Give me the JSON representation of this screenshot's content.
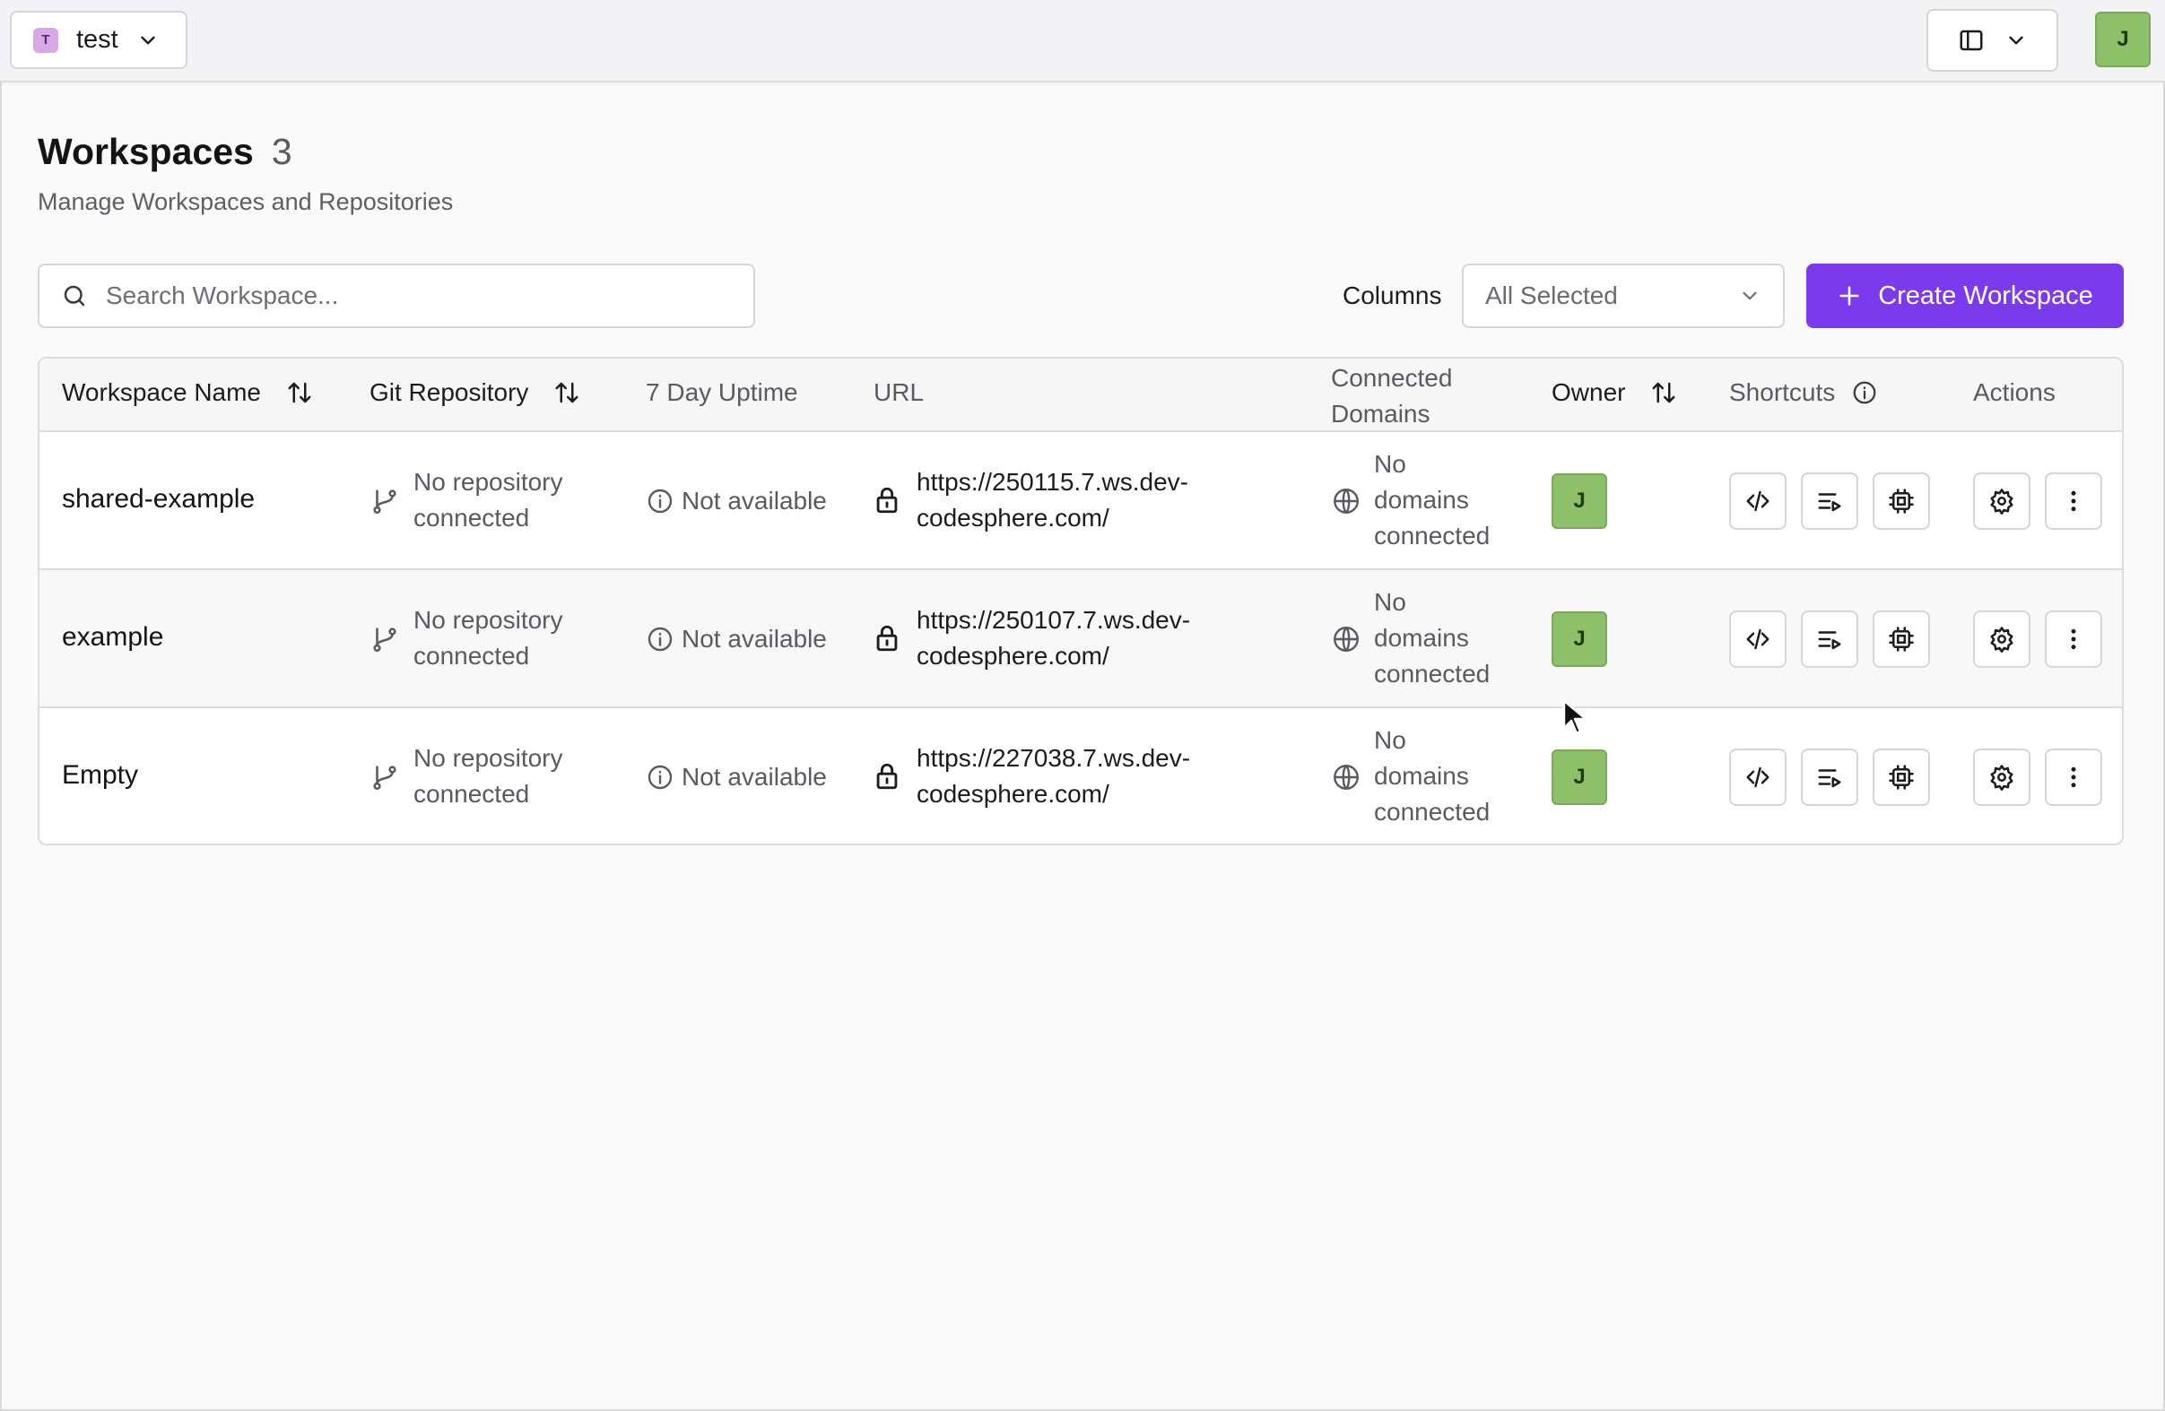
{
  "topbar": {
    "team_badge": "T",
    "team_name": "test",
    "user_initial": "J"
  },
  "header": {
    "title": "Workspaces",
    "count": "3",
    "subtitle": "Manage Workspaces and Repositories"
  },
  "toolbar": {
    "search_placeholder": "Search Workspace...",
    "columns_label": "Columns",
    "columns_value": "All Selected",
    "create_label": "Create Workspace"
  },
  "table": {
    "headers": {
      "name": "Workspace Name",
      "repo": "Git Repository",
      "uptime": "7 Day Uptime",
      "url": "URL",
      "domains_line1": "Connected",
      "domains_line2": "Domains",
      "owner": "Owner",
      "shortcuts": "Shortcuts",
      "actions": "Actions"
    },
    "rows": [
      {
        "name": "shared-example",
        "repo_line1": "No repository",
        "repo_line2": "connected",
        "uptime": "Not available",
        "url_line1": "https://250115.7.ws.dev-",
        "url_line2": "codesphere.com/",
        "domains_line1": "No",
        "domains_line2": "domains",
        "domains_line3": "connected",
        "owner": "J"
      },
      {
        "name": "example",
        "repo_line1": "No repository",
        "repo_line2": "connected",
        "uptime": "Not available",
        "url_line1": "https://250107.7.ws.dev-",
        "url_line2": "codesphere.com/",
        "domains_line1": "No",
        "domains_line2": "domains",
        "domains_line3": "connected",
        "owner": "J"
      },
      {
        "name": "Empty",
        "repo_line1": "No repository",
        "repo_line2": "connected",
        "uptime": "Not available",
        "url_line1": "https://227038.7.ws.dev-",
        "url_line2": "codesphere.com/",
        "domains_line1": "No",
        "domains_line2": "domains",
        "domains_line3": "connected",
        "owner": "J"
      }
    ]
  },
  "colors": {
    "accent": "#7c3aed",
    "avatar": "#8ec06a",
    "team_badge": "#d9a6e6"
  },
  "icons": [
    "chevron-down-icon",
    "sidebar-layout-icon",
    "search-icon",
    "plus-icon",
    "sort-icon",
    "info-icon",
    "git-branch-icon",
    "lock-icon",
    "globe-icon",
    "code-icon",
    "run-icon",
    "cpu-icon",
    "gear-icon",
    "kebab-menu-icon"
  ]
}
